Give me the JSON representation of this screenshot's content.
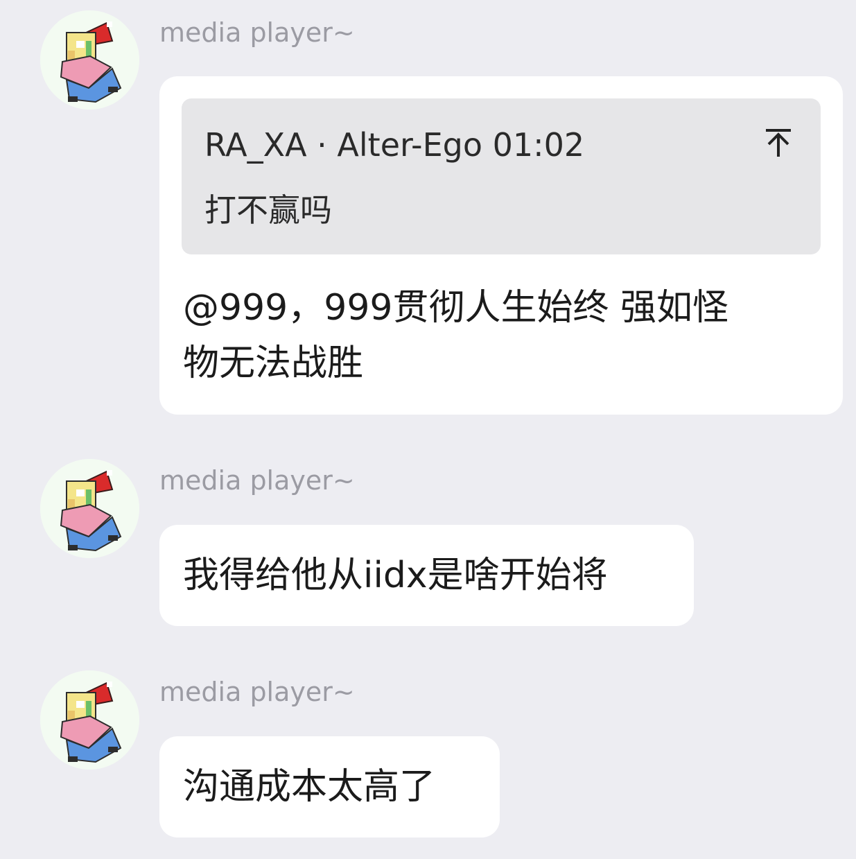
{
  "messages": [
    {
      "sender": "media player~",
      "avatar_icon": "pixel-girl-santa-hat-avatar",
      "quote": {
        "title": "RA_XA · Alter-Ego 01:02",
        "text": "打不赢吗",
        "jump_icon": "arrow-up-to-top-icon"
      },
      "text": "@999，999贯彻人生始终 强如怪\n物无法战胜"
    },
    {
      "sender": "media player~",
      "avatar_icon": "pixel-girl-santa-hat-avatar",
      "text": "我得给他从iidx是啥开始将"
    },
    {
      "sender": "media player~",
      "avatar_icon": "pixel-girl-santa-hat-avatar",
      "text": "沟通成本太高了"
    }
  ],
  "colors": {
    "background": "#ededf2",
    "bubble": "#ffffff",
    "quote_background": "#e6e6e8",
    "sender_name": "#9b9ba3",
    "text": "#1b1b1b"
  }
}
